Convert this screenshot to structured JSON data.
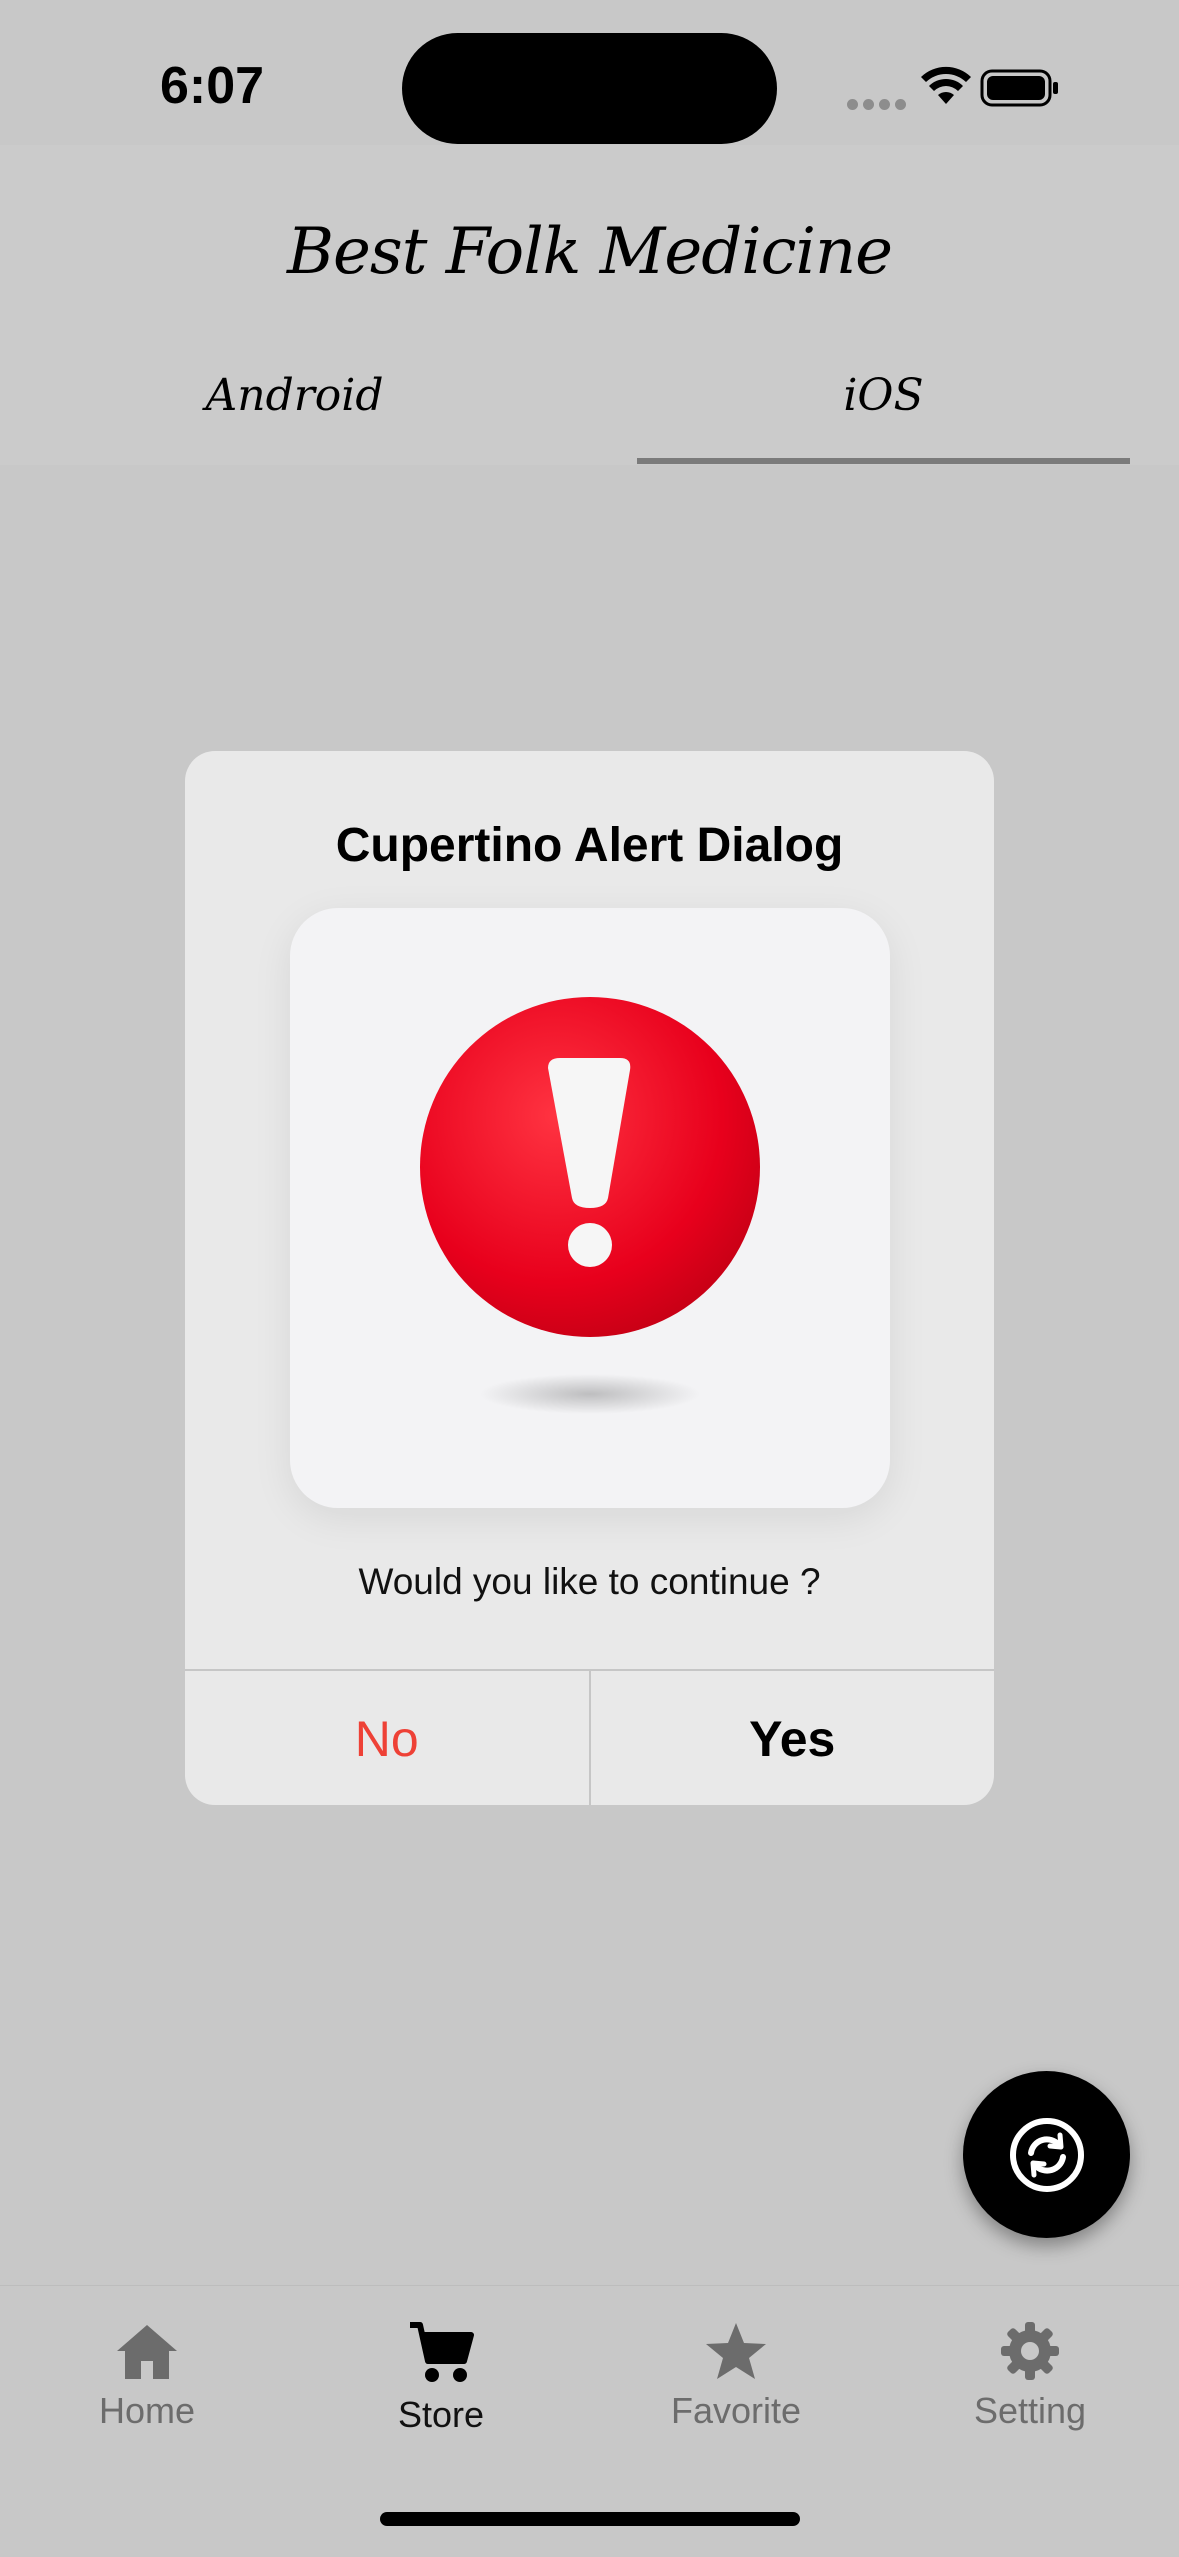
{
  "status_bar": {
    "time": "6:07"
  },
  "header": {
    "title": "Best Folk Medicine",
    "tabs": [
      {
        "label": "Android",
        "active": false
      },
      {
        "label": "iOS",
        "active": true
      }
    ]
  },
  "dialog": {
    "title": "Cupertino Alert Dialog",
    "image_icon": "warning-exclamation-icon",
    "message": "Would you like to continue ?",
    "cancel_label": "No",
    "confirm_label": "Yes"
  },
  "fab": {
    "icon": "refresh-sync-icon"
  },
  "bottom_nav": {
    "items": [
      {
        "label": "Home",
        "icon": "home-icon"
      },
      {
        "label": "Store",
        "icon": "cart-icon",
        "active": true
      },
      {
        "label": "Favorite",
        "icon": "star-icon"
      },
      {
        "label": "Setting",
        "icon": "gear-icon"
      }
    ]
  },
  "colors": {
    "background": "#c8c8c8",
    "dialog": "#e9e9e9",
    "destructive": "#ee4136",
    "alert_red": "#e8001c"
  }
}
